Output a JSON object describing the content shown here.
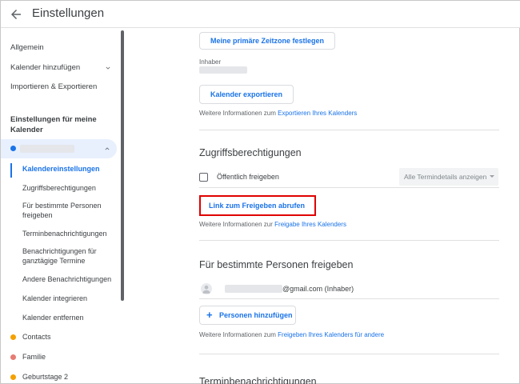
{
  "header": {
    "title": "Einstellungen"
  },
  "sidebar": {
    "general": "Allgemein",
    "add_calendar": "Kalender hinzufügen",
    "import_export": "Importieren & Exportieren",
    "my_calendars_section": "Einstellungen für meine Kalender",
    "sub_items": [
      "Kalendereinstellungen",
      "Zugriffsberechtigungen",
      "Für bestimmte Personen freigeben",
      "Terminbenachrichtigungen",
      "Benachrichtigungen für ganztägige Termine",
      "Andere Benachrichtigungen",
      "Kalender integrieren",
      "Kalender entfernen"
    ],
    "calendars": [
      {
        "name": "Contacts",
        "color": "#f4a100"
      },
      {
        "name": "Familie",
        "color": "#e67c73"
      },
      {
        "name": "Geburtstage 2",
        "color": "#f4a100"
      }
    ]
  },
  "main": {
    "timezone_button": "Meine primäre Zeitzone festlegen",
    "owner_label": "Inhaber",
    "export_button": "Kalender exportieren",
    "export_info_prefix": "Weitere Informationen zum",
    "export_info_link": "Exportieren Ihres Kalenders",
    "access_title": "Zugriffsberechtigungen",
    "public_label": "Öffentlich freigeben",
    "public_select": "Alle Termindetails anzeigen",
    "share_link_button": "Link zum Freigeben abrufen",
    "share_info_prefix": "Weitere Informationen zur",
    "share_info_link": "Freigabe Ihres Kalenders",
    "specific_title": "Für bestimmte Personen freigeben",
    "person_email": "@gmail.com (Inhaber)",
    "add_people_button": "Personen hinzufügen",
    "specific_info_prefix": "Weitere Informationen zum",
    "specific_info_link": "Freigeben Ihres Kalenders für andere",
    "notifications_title": "Terminbenachrichtigungen"
  },
  "colors": {
    "accent": "#1a73e8",
    "highlight": "#e00000",
    "selected_bg": "#e8f0fe",
    "calendar_dot": "#1a73e8"
  }
}
